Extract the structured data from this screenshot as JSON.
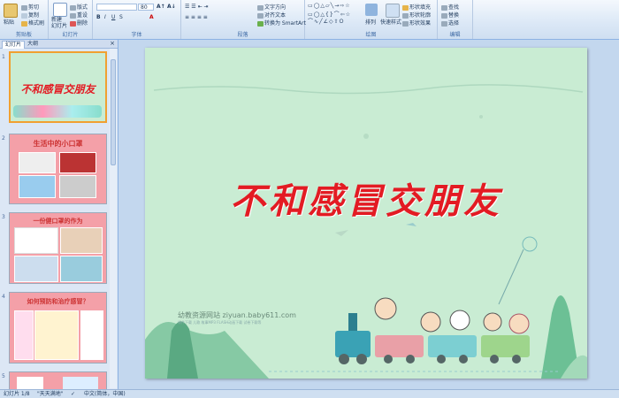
{
  "ribbon": {
    "clipboard": {
      "paste": "粘贴",
      "cut": "剪切",
      "copy": "复制",
      "format_painter": "格式刷",
      "label": "剪贴板"
    },
    "slides": {
      "new_slide": "新建\n幻灯片",
      "layout": "版式",
      "reset": "重设",
      "delete": "删除",
      "label": "幻灯片"
    },
    "font": {
      "font_size": "80",
      "label": "字体"
    },
    "paragraph": {
      "text_direction": "文字方向",
      "align_text": "对齐文本",
      "smartart": "转换为 SmartArt",
      "label": "段落"
    },
    "drawing": {
      "arrange": "排列",
      "quick_styles": "快速样式",
      "shape_fill": "形状填充",
      "shape_outline": "形状轮廓",
      "shape_effects": "形状效果",
      "label": "绘图"
    },
    "editing": {
      "find": "查找",
      "replace": "替换",
      "select": "选择",
      "label": "编辑"
    }
  },
  "pane": {
    "tab_slides": "幻灯片",
    "tab_outline": "大纲",
    "close": "×",
    "thumbs": [
      {
        "num": "1",
        "title": "不和感冒交朋友"
      },
      {
        "num": "2",
        "title": "生活中的小口罩"
      },
      {
        "num": "3",
        "title": "一份健口罩的作为"
      },
      {
        "num": "4",
        "title": "如何预防和治疗感冒？"
      },
      {
        "num": "5",
        "title": ""
      }
    ]
  },
  "slide": {
    "title": "不和感冒交朋友",
    "site": "幼教资源网站  ziyuan.baby611.com",
    "sub": "课件下载  儿歌  故事MP3  FLASH动画下载  试卷下载等"
  },
  "status": {
    "slide_info": "幻灯片 1/8",
    "theme": "\"天天满地\"",
    "language": "中文(简体，中国)"
  },
  "colors": {
    "title": "#e31b23",
    "slide_bg": "#c9ecd3",
    "selection": "#f0a030"
  }
}
